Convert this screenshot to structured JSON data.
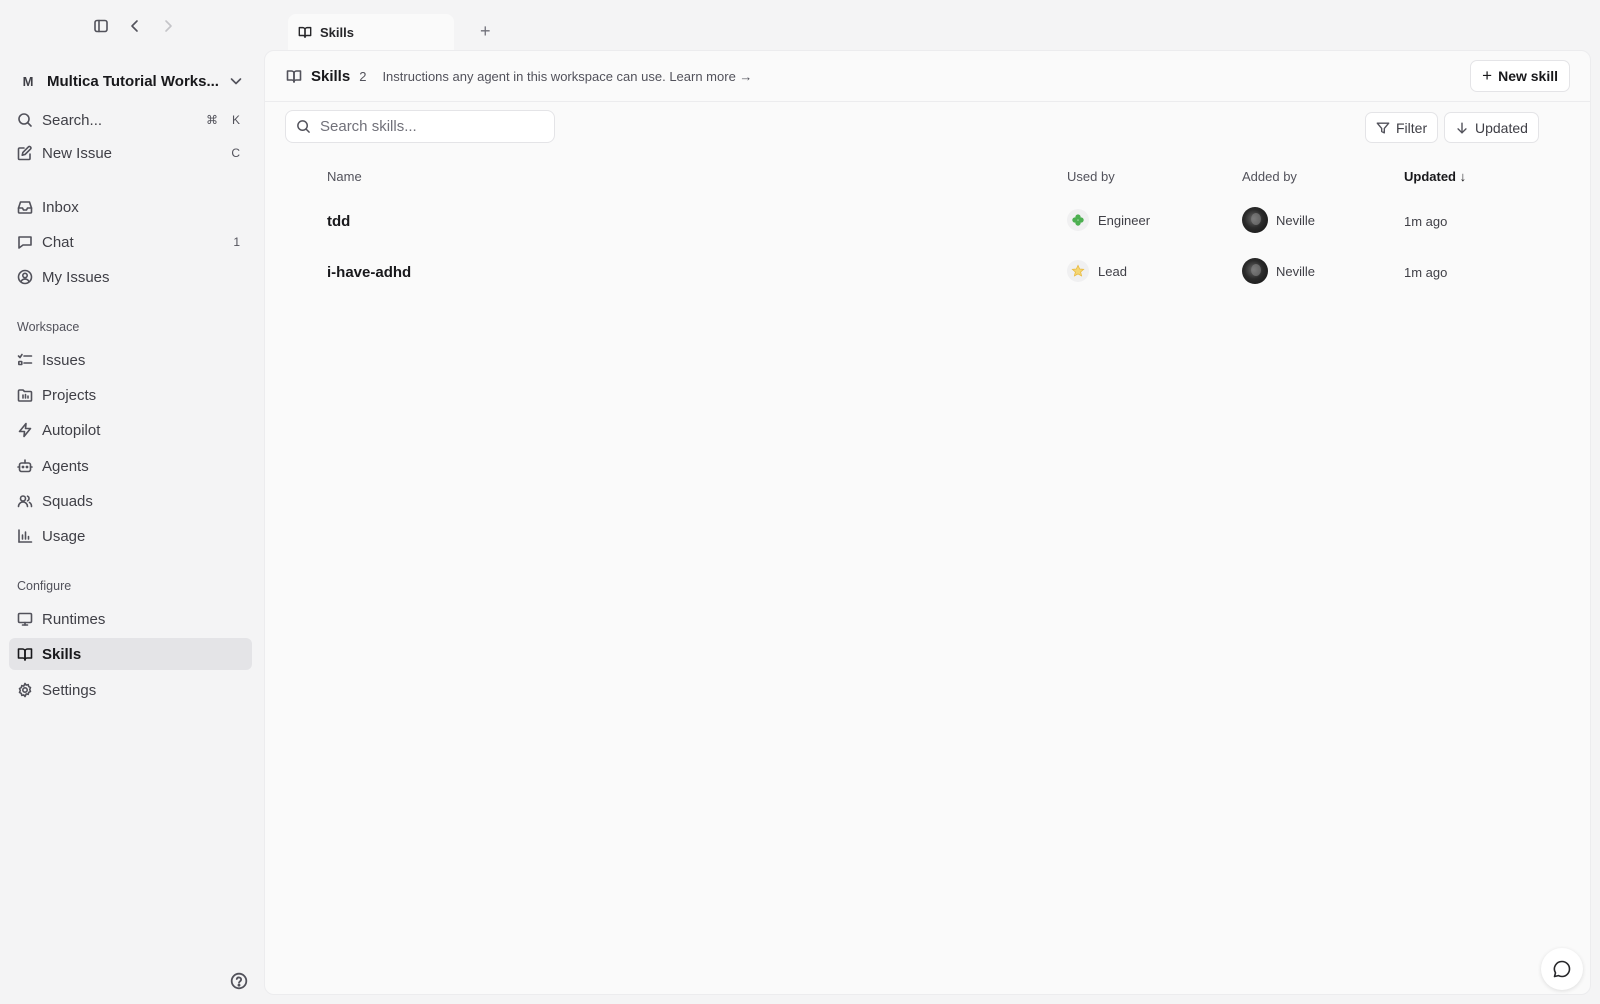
{
  "tab": {
    "label": "Skills",
    "add": "+"
  },
  "workspace": {
    "badge": "M",
    "name": "Multica Tutorial Works..."
  },
  "sidebar": {
    "search": {
      "label": "Search...",
      "kbd_mod": "⌘",
      "kbd_key": "K"
    },
    "new_issue": {
      "label": "New Issue",
      "kbd_key": "C"
    },
    "primary": [
      {
        "label": "Inbox",
        "icon": "inbox-icon"
      },
      {
        "label": "Chat",
        "icon": "chat-icon",
        "count": "1"
      },
      {
        "label": "My Issues",
        "icon": "user-circle-icon"
      }
    ],
    "workspace_section": "Workspace",
    "workspace_items": [
      {
        "label": "Issues",
        "icon": "list-icon"
      },
      {
        "label": "Projects",
        "icon": "folder-icon"
      },
      {
        "label": "Autopilot",
        "icon": "bolt-icon"
      },
      {
        "label": "Agents",
        "icon": "bot-icon"
      },
      {
        "label": "Squads",
        "icon": "users-icon"
      },
      {
        "label": "Usage",
        "icon": "bar-chart-icon"
      }
    ],
    "configure_section": "Configure",
    "configure_items": [
      {
        "label": "Runtimes",
        "icon": "monitor-icon"
      },
      {
        "label": "Skills",
        "icon": "book-icon",
        "active": true
      },
      {
        "label": "Settings",
        "icon": "gear-icon"
      }
    ]
  },
  "header": {
    "title": "Skills",
    "count": "2",
    "description": "Instructions any agent in this workspace can use. Learn more →",
    "new_button": "New skill"
  },
  "toolbar": {
    "search_placeholder": "Search skills...",
    "filter_label": "Filter",
    "sort_label": "Updated"
  },
  "table": {
    "columns": {
      "name": "Name",
      "used_by": "Used by",
      "added_by": "Added by",
      "updated": "Updated ↓"
    },
    "rows": [
      {
        "name": "tdd",
        "used_by": "Engineer",
        "used_by_icon": "clover-icon",
        "added_by": "Neville",
        "updated": "1m ago"
      },
      {
        "name": "i-have-adhd",
        "used_by": "Lead",
        "used_by_icon": "star-icon",
        "added_by": "Neville",
        "updated": "1m ago"
      }
    ]
  },
  "colors": {
    "accent_green": "#4caf50",
    "accent_gold": "#e8b634",
    "active_nav_bg": "#e4e4e7"
  }
}
